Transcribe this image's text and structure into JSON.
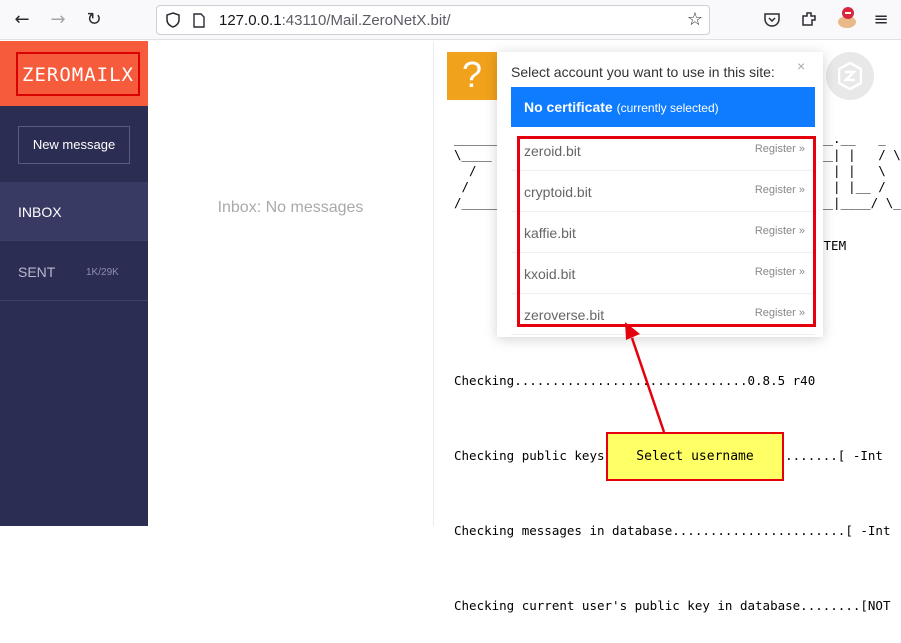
{
  "browser": {
    "url_host": "127.0.0.1",
    "url_rest": ":43110/Mail.ZeroNetX.bit/"
  },
  "sidebar": {
    "brand": "ZEROMAILX",
    "new_message": "New message",
    "items": [
      {
        "label": "INBOX",
        "count": ""
      },
      {
        "label": "SENT",
        "count": "1K/29K"
      }
    ]
  },
  "messages": {
    "empty_text": "Inbox: No messages"
  },
  "main": {
    "help_icon": "?",
    "ascii_art": "______\n\\____\n  /\n /\n/_____",
    "ascii_right": "__.__   _\n__| |   / \\\n  | |   \\\n  | |__ /\n__|____/ \\_",
    "ascii_stem": "STEM",
    "log_lines": [
      "Checking...............................0.8.5 r40",
      "Checking public keys in database...................[ -Int",
      "Checking messages in database.......................[ -Int",
      "Checking current user's public key in database........[NOT"
    ]
  },
  "cert_dialog": {
    "title": "Select account you want to use in this site:",
    "close": "×",
    "current_name": "No certificate",
    "current_note": "(currently selected)",
    "providers": [
      {
        "name": "zeroid.bit",
        "action": "Register »"
      },
      {
        "name": "cryptoid.bit",
        "action": "Register »"
      },
      {
        "name": "kaffie.bit",
        "action": "Register »"
      },
      {
        "name": "kxoid.bit",
        "action": "Register »"
      },
      {
        "name": "zeroverse.bit",
        "action": "Register »"
      }
    ]
  },
  "annotation": {
    "label": "Select username",
    "color": "#e5000e"
  }
}
